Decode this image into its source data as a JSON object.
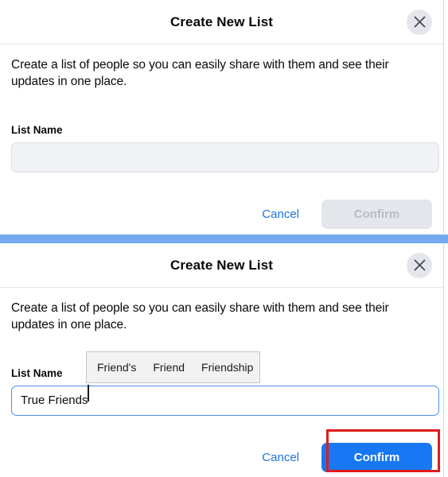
{
  "dialog_top": {
    "title": "Create New List",
    "close_icon": "close-icon",
    "description": "Create a list of people so you can easily share with them and see their updates in one place.",
    "field_label": "List Name",
    "input_value": "",
    "input_placeholder": "",
    "cancel_label": "Cancel",
    "confirm_label": "Confirm",
    "confirm_state": "disabled"
  },
  "dialog_bottom": {
    "title": "Create New List",
    "close_icon": "close-icon",
    "description": "Create a list of people so you can easily share with them and see their updates in one place.",
    "field_label": "List Name",
    "input_value": "True Friends",
    "input_placeholder": "",
    "cancel_label": "Cancel",
    "confirm_label": "Confirm",
    "confirm_state": "enabled"
  },
  "suggestions": {
    "items": [
      {
        "label": "Friend's"
      },
      {
        "label": "Friend"
      },
      {
        "label": "Friendship"
      }
    ]
  },
  "colors": {
    "accent_blue": "#1877f2",
    "link_blue": "#1b74e4",
    "band_blue": "#74a9f0",
    "input_focus_border": "#4a90e8",
    "disabled_bg": "#e4e6eb",
    "disabled_text": "#b9bcc1",
    "highlight_red": "#e01b1b",
    "suggest_bg": "#f2f2f2",
    "field_bg": "#f0f2f5"
  }
}
